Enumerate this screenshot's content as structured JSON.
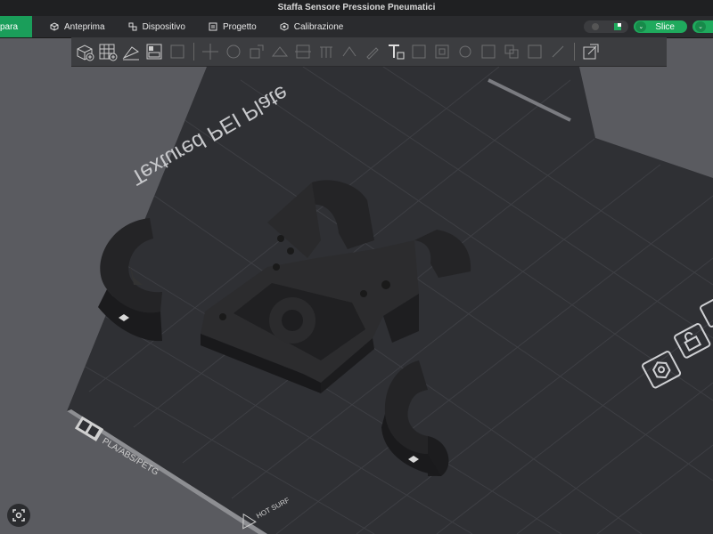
{
  "window": {
    "title": "Staffa Sensore Pressione Pneumatici"
  },
  "topbar": {
    "prepare_label": "para",
    "tabs": [
      {
        "label": "Anteprima",
        "icon": "cube-preview-icon"
      },
      {
        "label": "Dispositivo",
        "icon": "device-icon"
      },
      {
        "label": "Progetto",
        "icon": "project-icon"
      },
      {
        "label": "Calibrazione",
        "icon": "calibration-icon"
      }
    ],
    "slice_label": "Slice"
  },
  "plate": {
    "name_text": "Textured PEI Plate",
    "material_text": "PLA/ABS/PETG",
    "hot_text": "HOT SURF"
  },
  "colors": {
    "accent": "#1faa5d",
    "bed": "#2e2f33",
    "part": "#252527"
  }
}
